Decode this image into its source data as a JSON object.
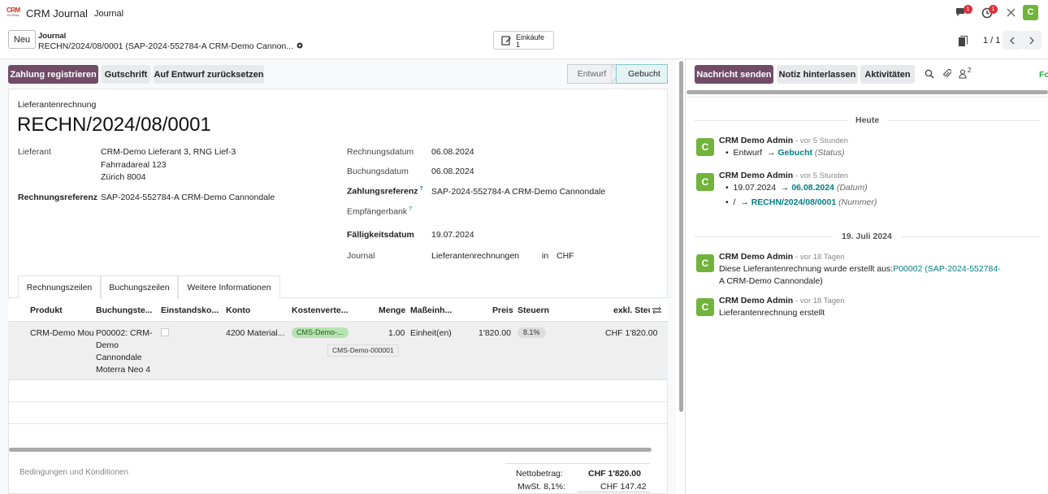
{
  "app": {
    "name": "CRM Journal",
    "menu": "Journal",
    "logo_top": "CRM",
    "logo_bottom": "JOURNAL",
    "user_initial": "C",
    "chat_badge": "1",
    "activity_badge": "1"
  },
  "control": {
    "new_label": "Neu",
    "breadcrumb_parent": "Journal",
    "breadcrumb_current": "RECHN/2024/08/0001 (SAP-2024-552784-A CRM-Demo Cannon...",
    "smart_label": "Einkäufe",
    "smart_count": "1",
    "pager": "1 / 1"
  },
  "actions": {
    "register_payment": "Zahlung registrieren",
    "credit_note": "Gutschrift",
    "reset_draft": "Auf Entwurf zurücksetzen"
  },
  "status": {
    "draft": "Entwurf",
    "posted": "Gebucht"
  },
  "form": {
    "type_label": "Lieferantenrechnung",
    "number": "RECHN/2024/08/0001",
    "vendor_label": "Lieferant",
    "vendor_name": "CRM-Demo Lieferant 3, RNG Lief-3",
    "vendor_street": "Fahrradareal 123",
    "vendor_city": "Zürich 8004",
    "bill_ref_label": "Rechnungsreferenz",
    "bill_ref": "SAP-2024-552784-A CRM-Demo Cannondale",
    "invoice_date_label": "Rechnungsdatum",
    "invoice_date": "06.08.2024",
    "accounting_date_label": "Buchungsdatum",
    "accounting_date": "06.08.2024",
    "payment_ref_label": "Zahlungsreferenz",
    "payment_ref": "SAP-2024-552784-A CRM-Demo Cannondale",
    "help_mark": "?",
    "bank_label": "Empfängerbank",
    "due_date_label": "Fälligkeitsdatum",
    "due_date": "19.07.2024",
    "journal_label": "Journal",
    "journal": "Lieferantenrechnungen",
    "in_label": "in",
    "currency": "CHF"
  },
  "tabs": [
    "Rechnungszeilen",
    "Buchungszeilen",
    "Weitere Informationen"
  ],
  "table": {
    "headers": [
      "Produkt",
      "Buchungste...",
      "Einstandsko...",
      "Konto",
      "Kostenverte...",
      "Menge",
      "Maßeinh...",
      "Preis",
      "Steuern",
      "exkl. Steu"
    ],
    "row": {
      "product": "CRM-Demo Mour",
      "label_lines": [
        "P00002: CRM-",
        "Demo",
        "Cannondale",
        "Moterra Neo 4"
      ],
      "account": "4200 Material...",
      "analytic": "CMS-Demo-...",
      "analytic_tooltip": "CMS-Demo-000001",
      "quantity": "1.00",
      "uom": "Einheit(en)",
      "price": "1'820.00",
      "tax": "8.1%",
      "subtotal": "CHF 1'820.00"
    }
  },
  "footer": {
    "terms": "Bedingungen und Konditionen",
    "net_label": "Nettobetrag:",
    "net_value": "CHF 1'820.00",
    "tax_label": "MwSt. 8,1%:",
    "tax_value": "CHF 147.42"
  },
  "chatter": {
    "send_message": "Nachricht senden",
    "log_note": "Notiz hinterlassen",
    "activities": "Aktivitäten",
    "followers_count": "2",
    "follow_cut": "Fo",
    "today": "Heute",
    "date_sep": "19. Juli 2024",
    "messages": [
      {
        "author": "CRM Demo Admin",
        "time": "- vor 5 Stunden",
        "old": "Entwurf",
        "new": "Gebucht",
        "field": "(Status)"
      },
      {
        "author": "CRM Demo Admin",
        "time": "- vor 5 Stunden",
        "old": "19.07.2024",
        "new": "06.08.2024",
        "field": "(Datum)",
        "old2": "/",
        "new2": "RECHN/2024/08/0001",
        "field2": "(Nummer)"
      },
      {
        "author": "CRM Demo Admin",
        "time": "- vor 18 Tagen",
        "text": "Diese Lieferantenrechnung wurde erstellt aus:",
        "link1": "P00002 (SAP-2024-552784-",
        "link2": "A CRM-Demo Cannondale)"
      },
      {
        "author": "CRM Demo Admin",
        "time": "- vor 18 Tagen",
        "text": "Lieferantenrechnung erstellt"
      }
    ]
  }
}
